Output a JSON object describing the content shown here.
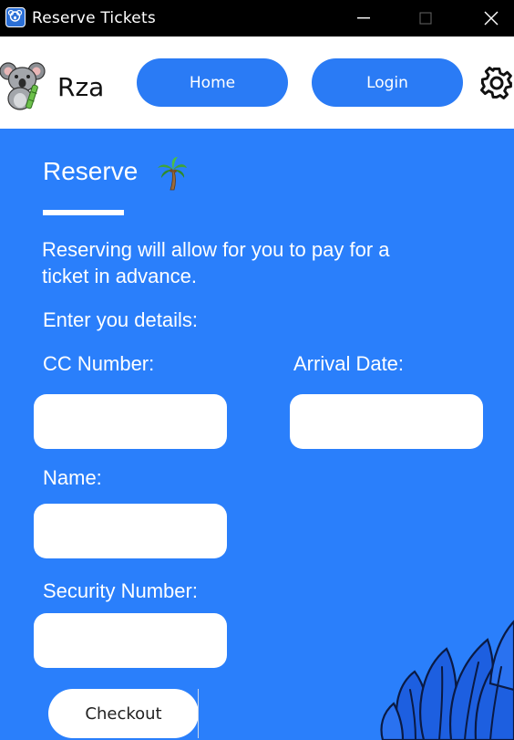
{
  "window": {
    "title": "Reserve Tickets"
  },
  "header": {
    "brand": "Rza",
    "nav": {
      "home_label": "Home",
      "login_label": "Login"
    }
  },
  "main": {
    "heading": "Reserve",
    "description": "Reserving will allow for you to pay for a ticket in advance.",
    "prompt": "Enter you details:",
    "fields": {
      "cc_label": "CC Number:",
      "arrival_label": "Arrival Date:",
      "name_label": "Name:",
      "security_label": "Security Number:",
      "cc_value": "",
      "arrival_value": "",
      "name_value": "",
      "security_value": ""
    },
    "checkout_label": "Checkout"
  },
  "icons": {
    "app": "koala-app-icon",
    "logo": "koala-logo",
    "heading_emoji": "palm-tree-icon",
    "settings": "gear-icon"
  },
  "colors": {
    "accent": "#2a7ffb",
    "nav_button": "#2a7bf5",
    "titlebar": "#000000",
    "header_bg": "#ffffff"
  }
}
